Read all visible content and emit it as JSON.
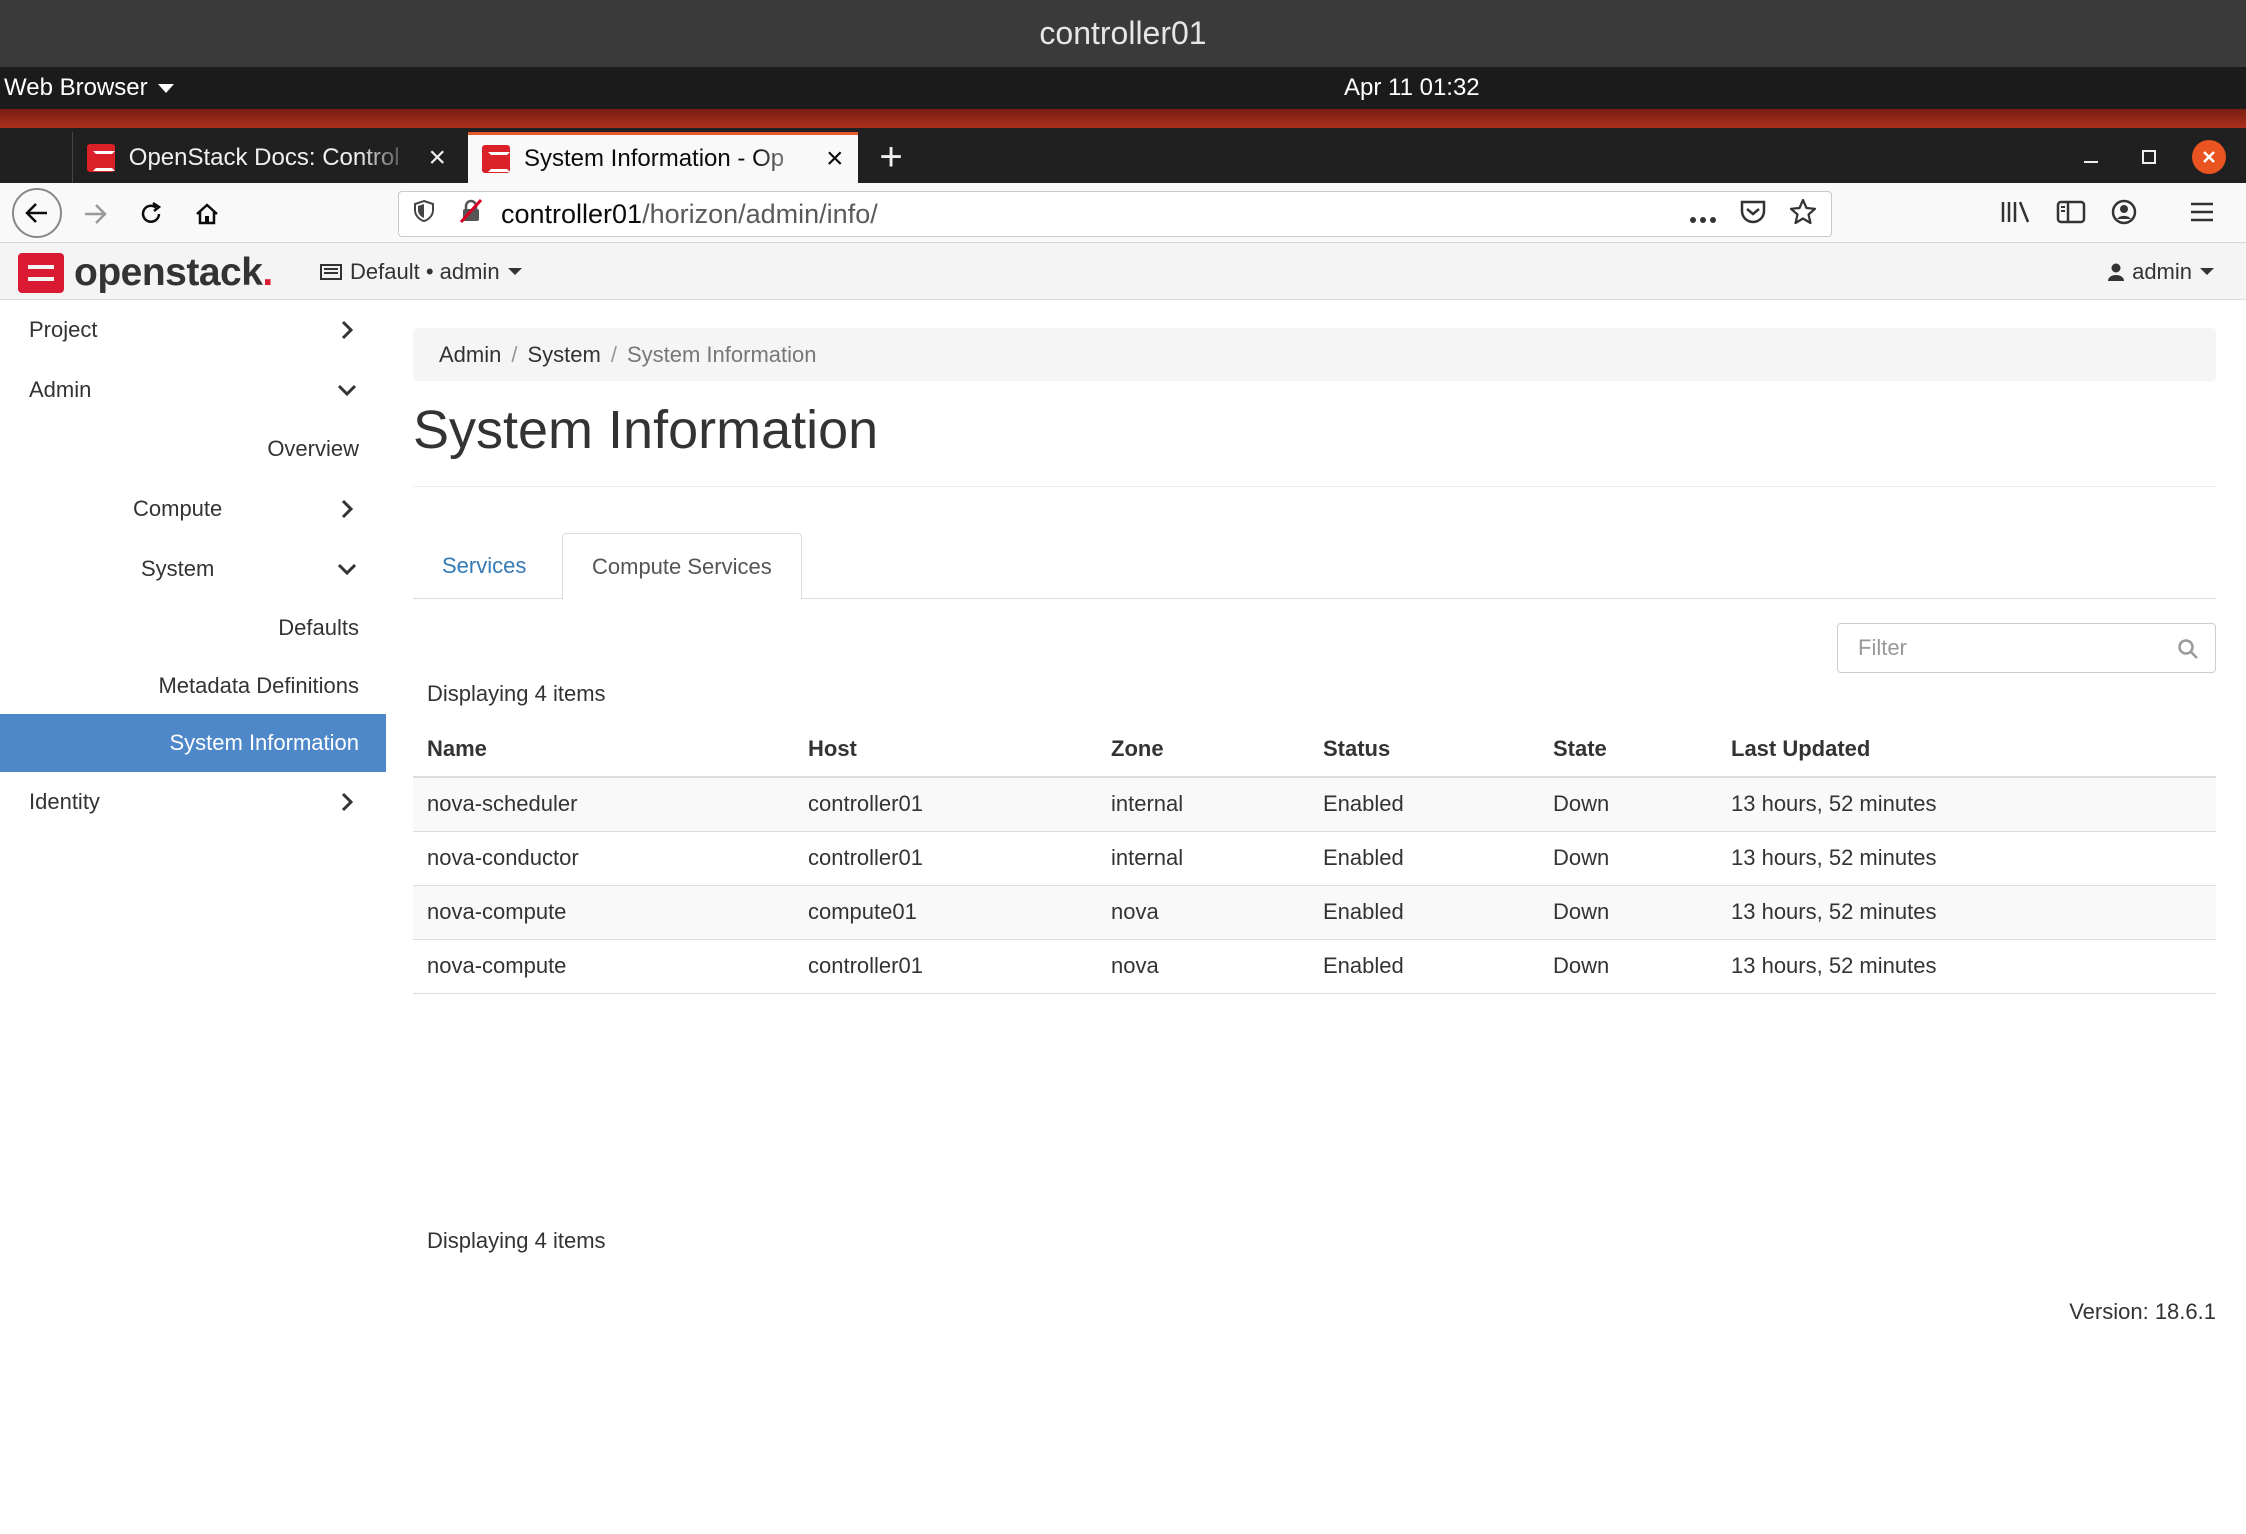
{
  "vm": {
    "title": "controller01"
  },
  "gnome": {
    "app_menu": "Web Browser",
    "clock": "Apr 11  01:32"
  },
  "browser": {
    "tabs": [
      {
        "title": "OpenStack Docs: Control"
      },
      {
        "title": "System Information - Op"
      }
    ],
    "url_host": "controller01",
    "url_path": "/horizon/admin/info/"
  },
  "horizon": {
    "brand": "openstack",
    "project": "Default • admin",
    "user": "admin",
    "sidebar": {
      "project": "Project",
      "admin": "Admin",
      "overview": "Overview",
      "compute": "Compute",
      "system": "System",
      "defaults": "Defaults",
      "metadata": "Metadata Definitions",
      "system_information": "System Information",
      "identity": "Identity"
    },
    "breadcrumb": [
      "Admin",
      "System",
      "System Information"
    ],
    "page_title": "System Information",
    "tabs": [
      "Services",
      "Compute Services"
    ],
    "filter_placeholder": "Filter",
    "count_text": "Displaying 4 items",
    "columns": [
      "Name",
      "Host",
      "Zone",
      "Status",
      "State",
      "Last Updated"
    ],
    "rows": [
      [
        "nova-scheduler",
        "controller01",
        "internal",
        "Enabled",
        "Down",
        "13 hours, 52 minutes"
      ],
      [
        "nova-conductor",
        "controller01",
        "internal",
        "Enabled",
        "Down",
        "13 hours, 52 minutes"
      ],
      [
        "nova-compute",
        "compute01",
        "nova",
        "Enabled",
        "Down",
        "13 hours, 52 minutes"
      ],
      [
        "nova-compute",
        "controller01",
        "nova",
        "Enabled",
        "Down",
        "13 hours, 52 minutes"
      ]
    ],
    "version": "Version: 18.6.1"
  },
  "colors": {
    "accent": "#4e88c9",
    "brand_red": "#da1a32",
    "link": "#337ab7",
    "ubuntu_orange": "#e95420"
  }
}
